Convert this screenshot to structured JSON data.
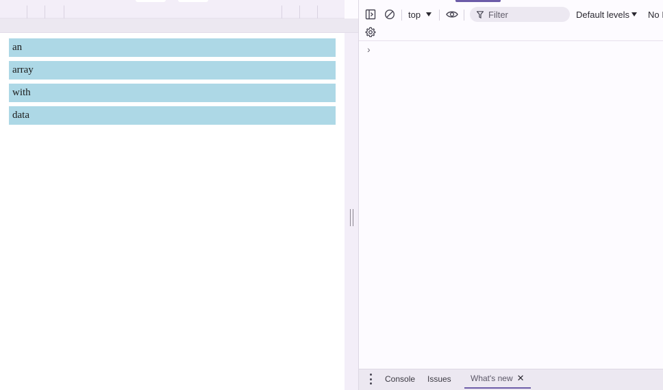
{
  "page": {
    "list_items": [
      "an",
      "array",
      "with",
      "data"
    ]
  },
  "devtools": {
    "toolbar": {
      "context_label": "top",
      "filter_placeholder": "Filter",
      "levels_label": "Default levels",
      "issues_label": "No I"
    },
    "console": {
      "prompt_symbol": "›"
    },
    "drawer": {
      "tabs": [
        {
          "label": "Console"
        },
        {
          "label": "Issues"
        },
        {
          "label": "What's new",
          "close": "✕"
        }
      ]
    }
  },
  "colors": {
    "list_item_bg": "#add8e6",
    "accent": "#6c5ca8"
  }
}
